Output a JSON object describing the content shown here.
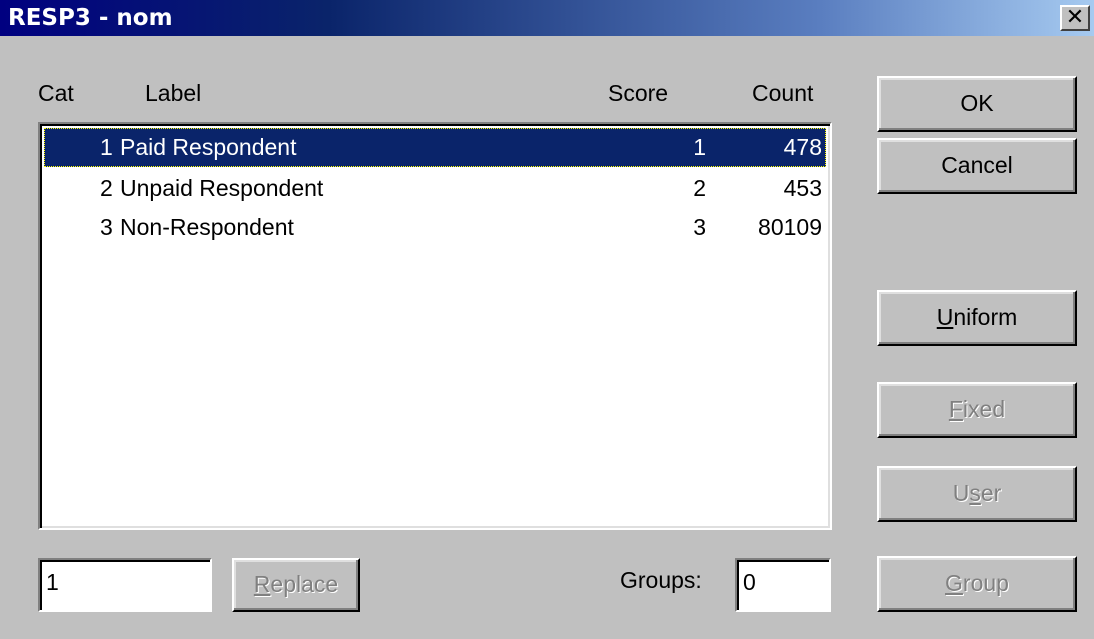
{
  "window": {
    "title": "RESP3 - nom",
    "close_glyph": "✕"
  },
  "headers": {
    "cat": "Cat",
    "label": "Label",
    "score": "Score",
    "count": "Count"
  },
  "rows": [
    {
      "cat": "1",
      "label": "Paid Respondent",
      "score": "1",
      "count": "478",
      "selected": true
    },
    {
      "cat": "2",
      "label": "Unpaid Respondent",
      "score": "2",
      "count": "453",
      "selected": false
    },
    {
      "cat": "3",
      "label": "Non-Respondent",
      "score": "3",
      "count": "80109",
      "selected": false
    }
  ],
  "buttons": {
    "ok": "OK",
    "cancel": "Cancel",
    "uniform": {
      "mnemonic": "U",
      "rest": "niform"
    },
    "fixed": {
      "mnemonic": "F",
      "rest": "ixed"
    },
    "user": {
      "pre": "U",
      "mnemonic": "s",
      "rest": "er"
    },
    "group": {
      "mnemonic": "G",
      "rest": "roup"
    },
    "replace": {
      "mnemonic": "R",
      "rest": "eplace"
    }
  },
  "inputs": {
    "score_value": "1",
    "groups_value": "0"
  },
  "labels": {
    "groups": "Groups:"
  }
}
